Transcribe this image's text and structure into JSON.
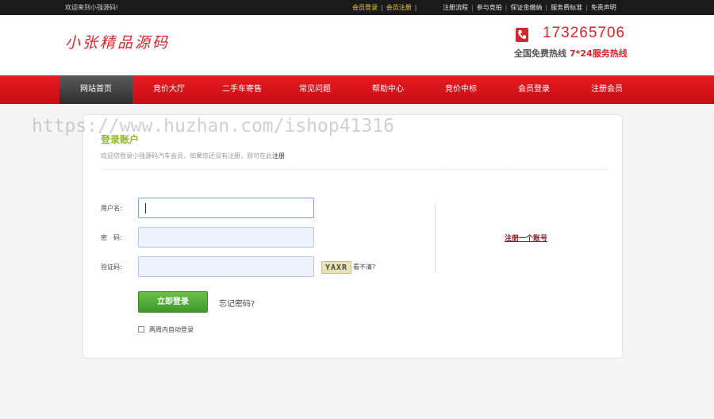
{
  "topbar": {
    "welcome": "欢迎来到小强源码!",
    "member_login": "会员登录",
    "member_register": "会员注册",
    "links": [
      "注册流程",
      "参与竞拍",
      "保证金缴纳",
      "服务费标准",
      "免责声明"
    ]
  },
  "header": {
    "logo": "小张精品源码",
    "phone": "173265706",
    "hotline_label": "全国免费热线",
    "hotline_service": "7*24服务热线"
  },
  "nav": {
    "items": [
      {
        "label": "网站首页",
        "active": true
      },
      {
        "label": "竞价大厅",
        "active": false
      },
      {
        "label": "二手车寄售",
        "active": false
      },
      {
        "label": "常见问题",
        "active": false
      },
      {
        "label": "帮助中心",
        "active": false
      },
      {
        "label": "竞价中标",
        "active": false
      },
      {
        "label": "会员登录",
        "active": false
      },
      {
        "label": "注册会员",
        "active": false
      }
    ]
  },
  "watermark": "https://www.huzhan.com/ishop41316",
  "login": {
    "title": "登录账户",
    "subtitle": "欢迎您登录小强源码汽车会员，如果您还没有注册，则可在此",
    "subtitle_link": "注册",
    "username_label": "用户名:",
    "username_value": "",
    "password_label": "密　码:",
    "password_value": "",
    "captcha_label": "验证码:",
    "captcha_value": "",
    "captcha_text": "YAXR",
    "captcha_unclear": "看不清?",
    "submit_label": "立即登录",
    "forgot_label": "忘记密码?",
    "auto_login_label": "两周内自动登录",
    "register_account": "注册一个账号"
  },
  "colors": {
    "brand_red": "#d8262e",
    "nav_red": "#e81a22",
    "title_green": "#8dbd1f",
    "button_green": "#4ea935"
  }
}
